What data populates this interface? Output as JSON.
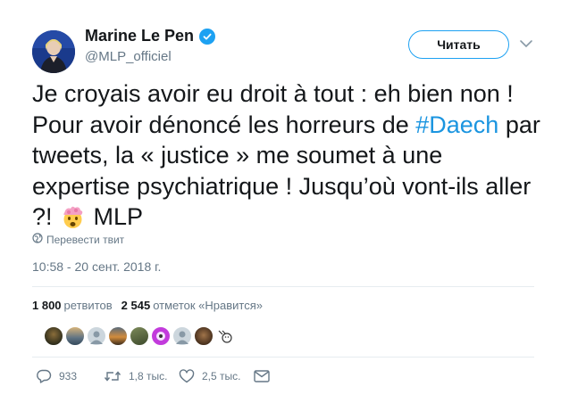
{
  "author": {
    "name": "Marine Le Pen",
    "handle": "@MLP_officiel",
    "verified": true
  },
  "follow_button": {
    "label": "Читать"
  },
  "tweet": {
    "text_before_hashtag": "Je croyais avoir eu droit à tout : eh bien non ! Pour avoir dénoncé les horreurs de ",
    "hashtag": "#Daech",
    "text_after_hashtag": " par tweets, la « justice » me soumet à une expertise psychiatrique ! Jusqu’où vont-ils aller ?! ",
    "emoji": "mind-blown-emoji",
    "signature": " MLP"
  },
  "translate_link": {
    "label": "Перевести твит"
  },
  "timestamp": "10:58 - 20 сент. 2018 г.",
  "stats": {
    "retweets_count": "1 800",
    "retweets_label": "ретвитов",
    "likes_count": "2 545",
    "likes_label": "отметок «Нравится»"
  },
  "likers": [
    {
      "name": "liker-avatar-1",
      "color": "#3a3f2a"
    },
    {
      "name": "liker-avatar-2",
      "color": "#6b7d8a"
    },
    {
      "name": "liker-avatar-3",
      "color": "#a5b1bb"
    },
    {
      "name": "liker-avatar-4",
      "color": "#c9853b"
    },
    {
      "name": "liker-avatar-5",
      "color": "#5f6f4b"
    },
    {
      "name": "liker-avatar-6",
      "color": "#b52fd8"
    },
    {
      "name": "liker-avatar-7",
      "color": "#a5b1bb"
    },
    {
      "name": "liker-avatar-8",
      "color": "#5a3e2b"
    },
    {
      "name": "liker-avatar-9",
      "color": "#e8e8e8"
    }
  ],
  "actions": {
    "reply_count": "933",
    "retweet_count": "1,8 тыс.",
    "like_count": "2,5 тыс."
  },
  "colors": {
    "accent": "#1da1f2",
    "hashtag": "#1b95e0",
    "muted": "#657786",
    "divider": "#e6ecf0"
  }
}
